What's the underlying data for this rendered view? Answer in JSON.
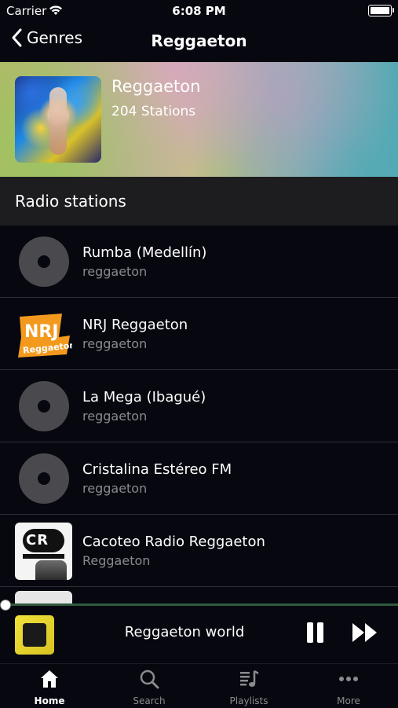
{
  "status_bar": {
    "carrier": "Carrier",
    "time": "6:08 PM"
  },
  "nav": {
    "back_label": "Genres",
    "title": "Reggaeton"
  },
  "genre": {
    "name": "Reggaeton",
    "station_count": "204 Stations"
  },
  "section_label": "Radio stations",
  "stations": [
    {
      "name": "Rumba (Medellín)",
      "genre": "reggaeton",
      "logo": "disc-placeholder-icon"
    },
    {
      "name": "NRJ Reggaeton",
      "genre": "reggaeton",
      "logo": "nrj-logo"
    },
    {
      "name": "La Mega (Ibagué)",
      "genre": "reggaeton",
      "logo": "disc-placeholder-icon"
    },
    {
      "name": "Cristalina Estéreo FM",
      "genre": "reggaeton",
      "logo": "disc-placeholder-icon"
    },
    {
      "name": "Cacoteo Radio Reggaeton",
      "genre": "Reggaeton",
      "logo": "cr-logo"
    }
  ],
  "logo_text": {
    "nrj_top": "NRJ",
    "nrj_bottom": "Reggaeton",
    "cr": "CR"
  },
  "player": {
    "now_playing": "Reggaeton world",
    "progress": 0.0
  },
  "tabs": [
    {
      "label": "Home",
      "icon": "home-icon",
      "active": true
    },
    {
      "label": "Search",
      "icon": "search-icon",
      "active": false
    },
    {
      "label": "Playlists",
      "icon": "playlists-icon",
      "active": false
    },
    {
      "label": "More",
      "icon": "more-icon",
      "active": false
    }
  ],
  "colors": {
    "background": "#06070f",
    "section_header": "#1d1d1f",
    "progress_track": "#2f5a3f",
    "secondary_text": "#8a8a90"
  }
}
